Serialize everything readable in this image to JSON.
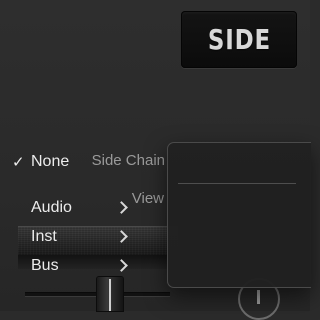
{
  "plugin": {
    "side_button_label": "SIDE",
    "side_chain_label": "Side Chain",
    "view_label": "View"
  },
  "menu": {
    "selected": "None",
    "items": [
      {
        "label": "None",
        "checked": true,
        "has_submenu": false
      },
      {
        "label": "Audio",
        "checked": false,
        "has_submenu": true
      },
      {
        "label": "Inst",
        "checked": false,
        "has_submenu": true
      },
      {
        "label": "Bus",
        "checked": false,
        "has_submenu": true
      }
    ],
    "check_glyph": "✓"
  },
  "colors": {
    "background": "#2b2b2b",
    "menu_background": "#212121",
    "menu_text": "#ececec",
    "label_text": "#9a9a9a",
    "button_background": "#111111",
    "button_text": "#d8d8d8"
  },
  "icons": {
    "checkmark": "checkmark-icon",
    "submenu_arrow": "chevron-right-icon"
  }
}
